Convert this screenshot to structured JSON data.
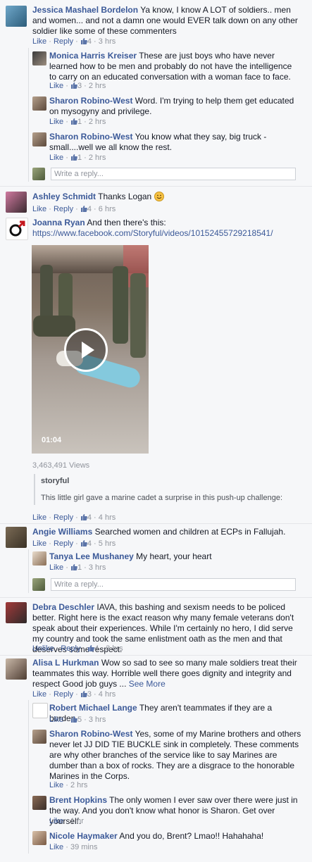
{
  "comments": {
    "c1": {
      "name": "Jessica Mashael Bordelon",
      "text": "Ya know, I know A LOT of soldiers.. men and women... and not a damn one would EVER talk down on any other soldier like some of these commenters",
      "actions": "Like · Reply · ",
      "likes": "4",
      "time": "3 hrs"
    },
    "c1r1": {
      "name": "Monica Harris Kreiser",
      "text": "These are just boys who have never learned how to be men and probably do not have the intelligence to carry on an educated conversation with a woman face to face.",
      "likes": "3",
      "time": "2 hrs"
    },
    "c1r2": {
      "name": "Sharon Robino-West",
      "text": "Word. I'm trying to help them get educated on mysogyny and privilege.",
      "likes": "1",
      "time": "2 hrs"
    },
    "c1r3": {
      "name": "Sharon Robino-West",
      "text": "You know what they say, big truck - small....well we all know the rest.",
      "likes": "1",
      "time": "2 hrs"
    },
    "c2": {
      "name": "Ashley Schmidt",
      "text": "Thanks Logan",
      "likes": "4",
      "time": "6 hrs"
    },
    "c3": {
      "name": "Joanna Ryan",
      "text": "And then there's this:",
      "url": "https://www.facebook.com/Storyful/videos/10152455729218541/",
      "likes": "4",
      "time": "4 hrs"
    },
    "c4": {
      "name": "Angie Williams",
      "text": "Searched women and children at ECPs in Fallujah.",
      "likes": "4",
      "time": "5 hrs"
    },
    "c4r1": {
      "name": "Tanya Lee Mushaney",
      "text": "My heart, your heart",
      "likes": "1",
      "time": "3 hrs"
    },
    "c5": {
      "name": "Debra Deschler",
      "text": "IAVA, this bashing and sexism needs to be policed better. Right here is the exact reason why many female veterans don't speak about their experiences. While I'm certainly no hero, I did serve my country and took the same enlistment oath as the men and that deserves some respect.",
      "unlike": "Unlike",
      "likes": "4",
      "time": "3 hrs"
    },
    "c6": {
      "name": "Alisa L Hurkman",
      "text": "Wow so sad to see so many male soldiers treat their teammates this way. Horrible well there goes dignity and integrity and respect Good job guys ...",
      "see_more": "See More",
      "likes": "3",
      "time": "4 hrs"
    },
    "c6r1": {
      "name": "Robert Michael Lange",
      "text": "They aren't teammates if they are a burden",
      "likes": "5",
      "time": "3 hrs"
    },
    "c6r2": {
      "name": "Sharon Robino-West",
      "text": "Yes, some of my Marine brothers and others never let JJ DID TIE BUCKLE sink in completely. These comments are why other branches of the service like to say Marines are dumber than a box of rocks. They are a disgrace to the honorable Marines in the Corps.",
      "time": "2 hrs"
    },
    "c6r3": {
      "name": "Brent Hopkins",
      "text": "The only women I ever saw over there were just in the way. And you don't know what honor is Sharon. Get over yourself.",
      "time": "1 hr"
    },
    "c6r4": {
      "name": "Nicole Haymaker",
      "text": "And you do, Brent? Lmao!! Hahahaha!",
      "time": "39 mins"
    }
  },
  "common": {
    "like": "Like",
    "reply": "Reply",
    "sep": " · ",
    "write_reply": "Write a reply..."
  },
  "video": {
    "duration": "01:04",
    "views": "3,463,491 Views",
    "source": "storyful",
    "caption": "This little girl gave a marine cadet a surprise in this push-up challenge:"
  },
  "colors": {
    "link": "#3b5998",
    "meta": "#90949c",
    "bg": "#f6f7f9"
  }
}
